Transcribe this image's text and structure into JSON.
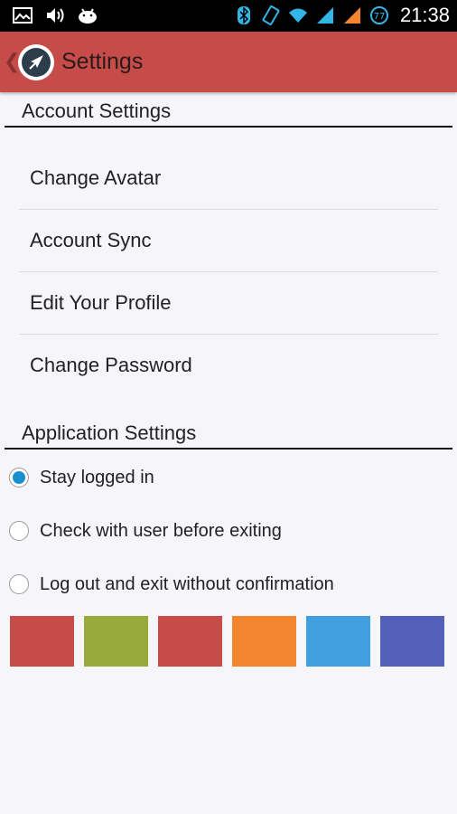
{
  "status_bar": {
    "left_icons": [
      "image-icon",
      "volume-icon",
      "android-icon"
    ],
    "right_icons": [
      "bluetooth-icon",
      "rotate-icon",
      "wifi-icon",
      "signal-icon",
      "signal-orange-icon",
      "badge-77-icon"
    ],
    "badge_number": "77",
    "time": "21:38"
  },
  "app_bar": {
    "title": "Settings",
    "back_glyph": "❮",
    "background": "#c64c4a"
  },
  "account_settings": {
    "header": "Account Settings",
    "items": [
      {
        "label": "Change Avatar"
      },
      {
        "label": "Account Sync"
      },
      {
        "label": "Edit Your Profile"
      },
      {
        "label": "Change Password"
      }
    ]
  },
  "application_settings": {
    "header": "Application Settings",
    "options": [
      {
        "label": "Stay logged in",
        "selected": true
      },
      {
        "label": "Check with user before exiting",
        "selected": false
      },
      {
        "label": "Log out and exit without confirmation",
        "selected": false
      }
    ]
  },
  "theme_colors": [
    "#c64c4a",
    "#97aa3a",
    "#c64c4a",
    "#f2852e",
    "#419fdf",
    "#5260ba"
  ]
}
